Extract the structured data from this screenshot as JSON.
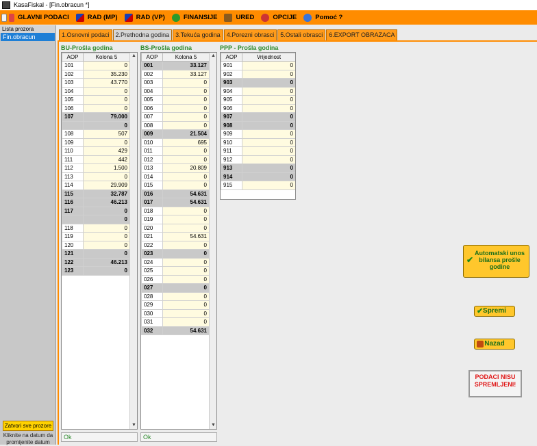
{
  "window": {
    "title": "KasaFiskal  - [Fin.obracun *]"
  },
  "menu": [
    {
      "label": "GLAVNI PODACI",
      "icon": "documents-icon"
    },
    {
      "label": "RAD (MP)",
      "icon": "flag-icon"
    },
    {
      "label": "RAD (VP)",
      "icon": "flag-icon"
    },
    {
      "label": "FINANSIJE",
      "icon": "finance-icon"
    },
    {
      "label": "URED",
      "icon": "folder-icon"
    },
    {
      "label": "OPCIJE",
      "icon": "options-icon"
    },
    {
      "label": "Pomoć ?",
      "icon": "help-icon"
    }
  ],
  "sidebar": {
    "label": "Lista prozora",
    "items": [
      "Fin.obracun"
    ],
    "close_all": "Zatvori sve prozore",
    "hint": "Kliknite na datum da promijenite datum"
  },
  "tabs": [
    {
      "label": "1.Osnovni podaci",
      "active": false
    },
    {
      "label": "2.Prethodna godina",
      "active": true
    },
    {
      "label": "3.Tekuća godina",
      "active": false
    },
    {
      "label": "4.Porezni obrasci",
      "active": false
    },
    {
      "label": "5.Ostali obrasci",
      "active": false
    },
    {
      "label": "6.EXPORT OBRAZACA",
      "active": false
    }
  ],
  "grids": {
    "bu": {
      "title": "BU-Prošla godina",
      "headers": [
        "AOP",
        "Kolona 5"
      ],
      "rows": [
        [
          "101",
          "0",
          false
        ],
        [
          "102",
          "35.230",
          false
        ],
        [
          "103",
          "43.770",
          false
        ],
        [
          "104",
          "0",
          false
        ],
        [
          "105",
          "0",
          false
        ],
        [
          "106",
          "0",
          false
        ],
        [
          "107",
          "79.000",
          true
        ],
        [
          "",
          "0",
          true
        ],
        [
          "108",
          "507",
          false
        ],
        [
          "109",
          "0",
          false
        ],
        [
          "110",
          "429",
          false
        ],
        [
          "111",
          "442",
          false
        ],
        [
          "112",
          "1.500",
          false
        ],
        [
          "113",
          "0",
          false
        ],
        [
          "114",
          "29.909",
          false
        ],
        [
          "115",
          "32.787",
          true
        ],
        [
          "116",
          "46.213",
          true
        ],
        [
          "117",
          "0",
          true
        ],
        [
          "",
          "0",
          true
        ],
        [
          "118",
          "0",
          false
        ],
        [
          "119",
          "0",
          false
        ],
        [
          "120",
          "0",
          false
        ],
        [
          "121",
          "0",
          true
        ],
        [
          "122",
          "46.213",
          true
        ],
        [
          "123",
          "0",
          true
        ]
      ],
      "status": "Ok"
    },
    "bs": {
      "title": "BS-Prošla godina",
      "headers": [
        "AOP",
        "Kolona 5"
      ],
      "rows": [
        [
          "001",
          "33.127",
          true
        ],
        [
          "002",
          "33.127",
          false
        ],
        [
          "003",
          "0",
          false
        ],
        [
          "004",
          "0",
          false
        ],
        [
          "005",
          "0",
          false
        ],
        [
          "006",
          "0",
          false
        ],
        [
          "007",
          "0",
          false
        ],
        [
          "008",
          "0",
          false
        ],
        [
          "009",
          "21.504",
          true
        ],
        [
          "010",
          "695",
          false
        ],
        [
          "011",
          "0",
          false
        ],
        [
          "012",
          "0",
          false
        ],
        [
          "013",
          "20.809",
          false
        ],
        [
          "014",
          "0",
          false
        ],
        [
          "015",
          "0",
          false
        ],
        [
          "016",
          "54.631",
          true
        ],
        [
          "017",
          "54.631",
          true
        ],
        [
          "018",
          "0",
          false
        ],
        [
          "019",
          "0",
          false
        ],
        [
          "020",
          "0",
          false
        ],
        [
          "021",
          "54.631",
          false
        ],
        [
          "022",
          "0",
          false
        ],
        [
          "023",
          "0",
          true
        ],
        [
          "024",
          "0",
          false
        ],
        [
          "025",
          "0",
          false
        ],
        [
          "026",
          "0",
          false
        ],
        [
          "027",
          "0",
          true
        ],
        [
          "028",
          "0",
          false
        ],
        [
          "029",
          "0",
          false
        ],
        [
          "030",
          "0",
          false
        ],
        [
          "031",
          "0",
          false
        ],
        [
          "032",
          "54.631",
          true
        ]
      ],
      "status": "Ok"
    },
    "ppp": {
      "title": "PPP - Prošla godina",
      "headers": [
        "AOP",
        "Vrijednost"
      ],
      "rows": [
        [
          "901",
          "0",
          false
        ],
        [
          "902",
          "0",
          false
        ],
        [
          "903",
          "0",
          true
        ],
        [
          "904",
          "0",
          false
        ],
        [
          "905",
          "0",
          false
        ],
        [
          "906",
          "0",
          false
        ],
        [
          "907",
          "0",
          true
        ],
        [
          "908",
          "0",
          true
        ],
        [
          "909",
          "0",
          false
        ],
        [
          "910",
          "0",
          false
        ],
        [
          "911",
          "0",
          false
        ],
        [
          "912",
          "0",
          false
        ],
        [
          "913",
          "0",
          true
        ],
        [
          "914",
          "0",
          true
        ],
        [
          "915",
          "0",
          false
        ]
      ]
    }
  },
  "actions": {
    "auto_import": "Automatski unos bilansa prošle godine",
    "save": "Spremi",
    "back": "Nazad",
    "not_saved": "PODACI NISU SPREMLJENI!"
  }
}
